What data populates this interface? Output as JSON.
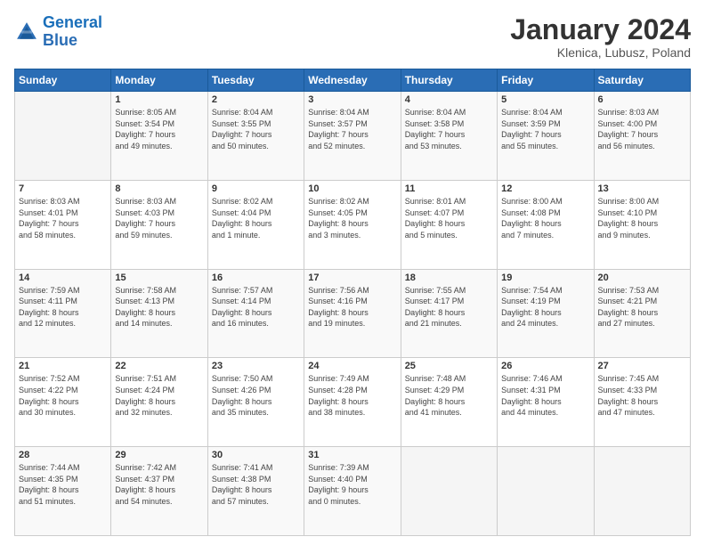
{
  "header": {
    "logo_line1": "General",
    "logo_line2": "Blue",
    "month_title": "January 2024",
    "location": "Klenica, Lubusz, Poland"
  },
  "weekdays": [
    "Sunday",
    "Monday",
    "Tuesday",
    "Wednesday",
    "Thursday",
    "Friday",
    "Saturday"
  ],
  "weeks": [
    [
      {
        "day": "",
        "info": ""
      },
      {
        "day": "1",
        "info": "Sunrise: 8:05 AM\nSunset: 3:54 PM\nDaylight: 7 hours\nand 49 minutes."
      },
      {
        "day": "2",
        "info": "Sunrise: 8:04 AM\nSunset: 3:55 PM\nDaylight: 7 hours\nand 50 minutes."
      },
      {
        "day": "3",
        "info": "Sunrise: 8:04 AM\nSunset: 3:57 PM\nDaylight: 7 hours\nand 52 minutes."
      },
      {
        "day": "4",
        "info": "Sunrise: 8:04 AM\nSunset: 3:58 PM\nDaylight: 7 hours\nand 53 minutes."
      },
      {
        "day": "5",
        "info": "Sunrise: 8:04 AM\nSunset: 3:59 PM\nDaylight: 7 hours\nand 55 minutes."
      },
      {
        "day": "6",
        "info": "Sunrise: 8:03 AM\nSunset: 4:00 PM\nDaylight: 7 hours\nand 56 minutes."
      }
    ],
    [
      {
        "day": "7",
        "info": "Sunrise: 8:03 AM\nSunset: 4:01 PM\nDaylight: 7 hours\nand 58 minutes."
      },
      {
        "day": "8",
        "info": "Sunrise: 8:03 AM\nSunset: 4:03 PM\nDaylight: 7 hours\nand 59 minutes."
      },
      {
        "day": "9",
        "info": "Sunrise: 8:02 AM\nSunset: 4:04 PM\nDaylight: 8 hours\nand 1 minute."
      },
      {
        "day": "10",
        "info": "Sunrise: 8:02 AM\nSunset: 4:05 PM\nDaylight: 8 hours\nand 3 minutes."
      },
      {
        "day": "11",
        "info": "Sunrise: 8:01 AM\nSunset: 4:07 PM\nDaylight: 8 hours\nand 5 minutes."
      },
      {
        "day": "12",
        "info": "Sunrise: 8:00 AM\nSunset: 4:08 PM\nDaylight: 8 hours\nand 7 minutes."
      },
      {
        "day": "13",
        "info": "Sunrise: 8:00 AM\nSunset: 4:10 PM\nDaylight: 8 hours\nand 9 minutes."
      }
    ],
    [
      {
        "day": "14",
        "info": "Sunrise: 7:59 AM\nSunset: 4:11 PM\nDaylight: 8 hours\nand 12 minutes."
      },
      {
        "day": "15",
        "info": "Sunrise: 7:58 AM\nSunset: 4:13 PM\nDaylight: 8 hours\nand 14 minutes."
      },
      {
        "day": "16",
        "info": "Sunrise: 7:57 AM\nSunset: 4:14 PM\nDaylight: 8 hours\nand 16 minutes."
      },
      {
        "day": "17",
        "info": "Sunrise: 7:56 AM\nSunset: 4:16 PM\nDaylight: 8 hours\nand 19 minutes."
      },
      {
        "day": "18",
        "info": "Sunrise: 7:55 AM\nSunset: 4:17 PM\nDaylight: 8 hours\nand 21 minutes."
      },
      {
        "day": "19",
        "info": "Sunrise: 7:54 AM\nSunset: 4:19 PM\nDaylight: 8 hours\nand 24 minutes."
      },
      {
        "day": "20",
        "info": "Sunrise: 7:53 AM\nSunset: 4:21 PM\nDaylight: 8 hours\nand 27 minutes."
      }
    ],
    [
      {
        "day": "21",
        "info": "Sunrise: 7:52 AM\nSunset: 4:22 PM\nDaylight: 8 hours\nand 30 minutes."
      },
      {
        "day": "22",
        "info": "Sunrise: 7:51 AM\nSunset: 4:24 PM\nDaylight: 8 hours\nand 32 minutes."
      },
      {
        "day": "23",
        "info": "Sunrise: 7:50 AM\nSunset: 4:26 PM\nDaylight: 8 hours\nand 35 minutes."
      },
      {
        "day": "24",
        "info": "Sunrise: 7:49 AM\nSunset: 4:28 PM\nDaylight: 8 hours\nand 38 minutes."
      },
      {
        "day": "25",
        "info": "Sunrise: 7:48 AM\nSunset: 4:29 PM\nDaylight: 8 hours\nand 41 minutes."
      },
      {
        "day": "26",
        "info": "Sunrise: 7:46 AM\nSunset: 4:31 PM\nDaylight: 8 hours\nand 44 minutes."
      },
      {
        "day": "27",
        "info": "Sunrise: 7:45 AM\nSunset: 4:33 PM\nDaylight: 8 hours\nand 47 minutes."
      }
    ],
    [
      {
        "day": "28",
        "info": "Sunrise: 7:44 AM\nSunset: 4:35 PM\nDaylight: 8 hours\nand 51 minutes."
      },
      {
        "day": "29",
        "info": "Sunrise: 7:42 AM\nSunset: 4:37 PM\nDaylight: 8 hours\nand 54 minutes."
      },
      {
        "day": "30",
        "info": "Sunrise: 7:41 AM\nSunset: 4:38 PM\nDaylight: 8 hours\nand 57 minutes."
      },
      {
        "day": "31",
        "info": "Sunrise: 7:39 AM\nSunset: 4:40 PM\nDaylight: 9 hours\nand 0 minutes."
      },
      {
        "day": "",
        "info": ""
      },
      {
        "day": "",
        "info": ""
      },
      {
        "day": "",
        "info": ""
      }
    ]
  ]
}
